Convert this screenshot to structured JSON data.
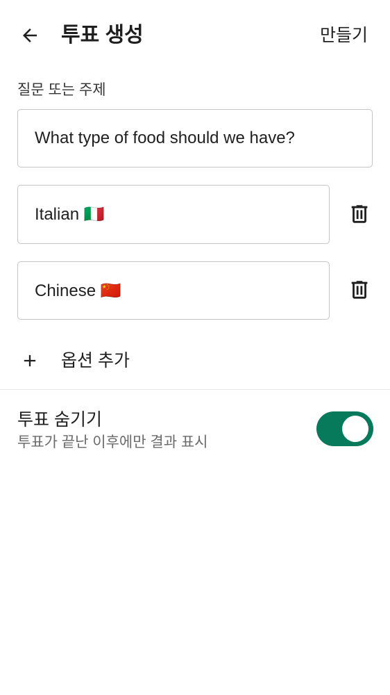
{
  "header": {
    "back_icon": "arrow-left-icon",
    "title": "투표 생성",
    "create_label": "만들기"
  },
  "question": {
    "label": "질문 또는 주제",
    "value": "What type of food should we have?"
  },
  "options": [
    {
      "value": "Italian 🇮🇹",
      "delete_icon": "trash-icon"
    },
    {
      "value": "Chinese 🇨🇳",
      "delete_icon": "trash-icon"
    }
  ],
  "add_option": {
    "icon": "plus-icon",
    "label": "옵션 추가"
  },
  "hide_votes": {
    "title": "투표 숨기기",
    "subtitle": "투표가 끝난 이후에만 결과 표시",
    "enabled": true
  },
  "colors": {
    "toggle_on": "#067A5B",
    "text_primary": "#1f1f1f",
    "text_secondary": "#6b6b6b",
    "field_border": "#c4c4c4"
  }
}
